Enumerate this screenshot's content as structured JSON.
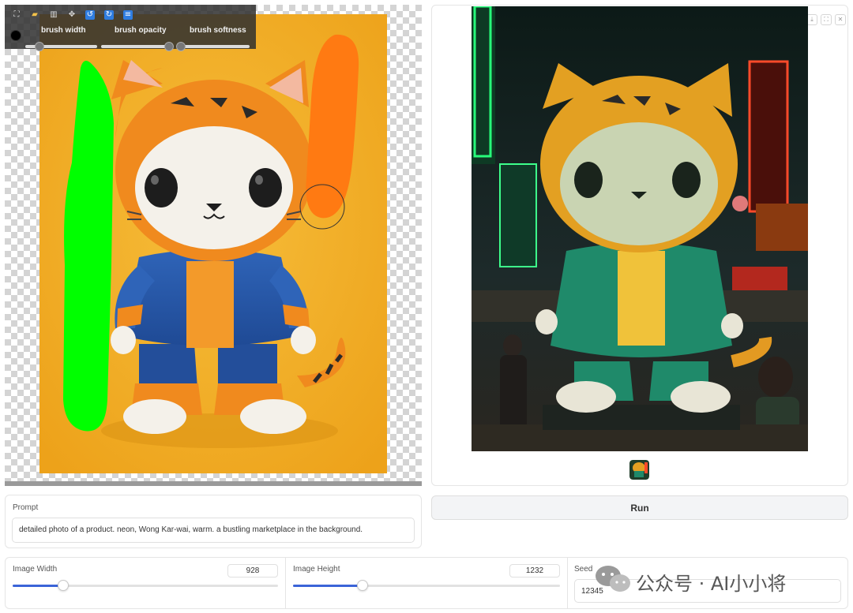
{
  "editor": {
    "toolbar": {
      "icons": [
        "fullscreen-icon",
        "open-folder-icon",
        "trash-icon",
        "move-icon",
        "undo-icon",
        "redo-icon",
        "layers-icon"
      ],
      "brush_color": "#000000",
      "brush_width_label": "brush width",
      "brush_opacity_label": "brush opacity",
      "brush_softness_label": "brush softness",
      "brush_width_level": 0.2,
      "brush_opacity_level": 0.95,
      "brush_softness_level": 0.02
    },
    "strokes": {
      "green": "#00ff00",
      "orange": "#ff7a12"
    }
  },
  "output": {
    "corner_buttons": [
      "download-icon",
      "fullscreen-icon",
      "close-icon"
    ]
  },
  "prompt": {
    "label": "Prompt",
    "value": "detailed photo of a product. neon, Wong Kar-wai, warm. a bustling marketplace in the background."
  },
  "run_label": "Run",
  "params": {
    "width": {
      "label": "Image Width",
      "value": "928",
      "level": 0.19
    },
    "height": {
      "label": "Image Height",
      "value": "1232",
      "level": 0.26
    },
    "seed": {
      "label": "Seed",
      "value": "12345"
    }
  },
  "watermark": {
    "text": "公众号 · AI小小将"
  },
  "colors": {
    "accent": "#3b64d8",
    "canvas_bg": "#f5b223"
  }
}
